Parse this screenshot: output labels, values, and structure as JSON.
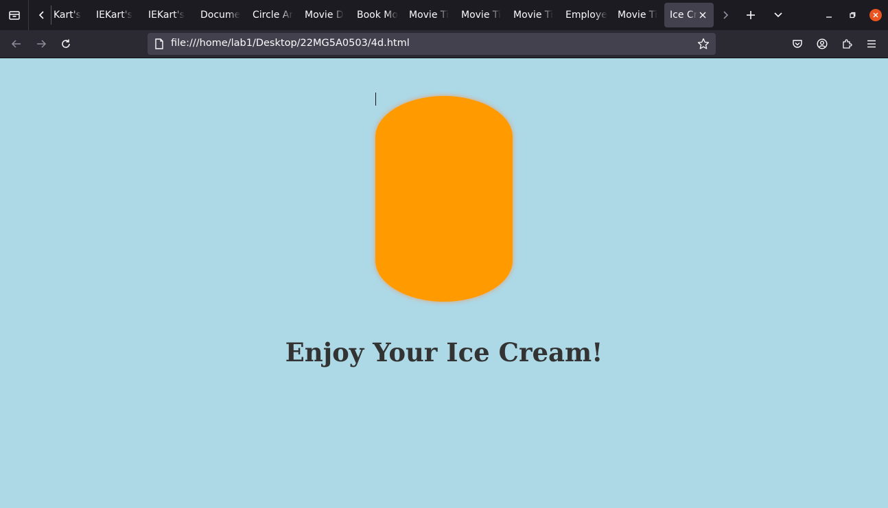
{
  "browser": {
    "tabs": [
      {
        "label": "Kart's"
      },
      {
        "label": "IEKart's"
      },
      {
        "label": "IEKart's"
      },
      {
        "label": "Docume"
      },
      {
        "label": "Circle Ar"
      },
      {
        "label": "Movie D"
      },
      {
        "label": "Book Mo"
      },
      {
        "label": "Movie Ti"
      },
      {
        "label": "Movie Ti"
      },
      {
        "label": "Movie Ti"
      },
      {
        "label": "Employe"
      },
      {
        "label": "Movie Ti"
      },
      {
        "label": "Ice Cr",
        "active": true
      }
    ],
    "url": "file:///home/lab1/Desktop/22MG5A0503/4d.html"
  },
  "page": {
    "heading": "Enjoy Your Ice Cream!",
    "scoop_color": "#ff9a00",
    "background_color": "#add8e6"
  }
}
